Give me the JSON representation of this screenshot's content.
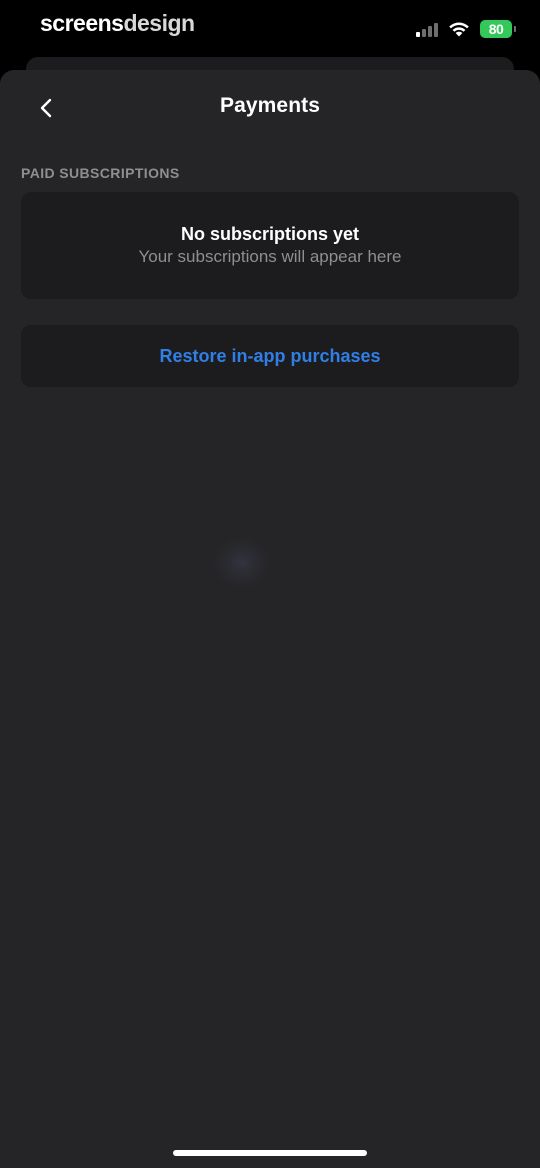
{
  "status_bar": {
    "brand_bold": "screens",
    "brand_light": "design",
    "battery_level": "80",
    "battery_color": "#34c759"
  },
  "nav": {
    "title": "Payments",
    "back_icon": "chevron-left-icon"
  },
  "subscriptions": {
    "section_header": "PAID SUBSCRIPTIONS",
    "empty_title": "No subscriptions yet",
    "empty_subtitle": "Your subscriptions will appear here"
  },
  "actions": {
    "restore_label": "Restore in-app purchases",
    "restore_color": "#2f7fe6"
  },
  "theme": {
    "background": "#000000",
    "sheet": "#252527",
    "card": "#1c1c1e",
    "secondary_text": "#8e8e93"
  }
}
